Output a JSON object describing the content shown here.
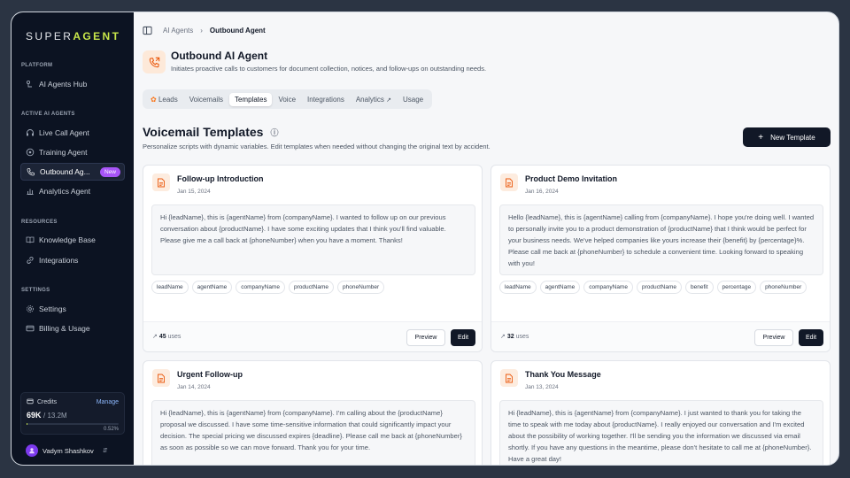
{
  "sidebar": {
    "brand_a": "SUPER",
    "brand_b": "AGENT",
    "sections": {
      "platform": "PLATFORM",
      "active": "ACTIVE AI AGENTS",
      "resources": "RESOURCES",
      "settings": "SETTINGS"
    },
    "items": {
      "hub": "AI Agents Hub",
      "live": "Live Call Agent",
      "training": "Training Agent",
      "outbound": "Outbound Ag...",
      "analytics": "Analytics Agent",
      "kb": "Knowledge Base",
      "integrations": "Integrations",
      "settings": "Settings",
      "billing": "Billing & Usage"
    },
    "new_badge": "New",
    "credits": {
      "label": "Credits",
      "manage": "Manage",
      "used": "69K",
      "total": "/ 13.2M",
      "percent": "0.52%",
      "fraction": 0.0052
    },
    "user": "Vadym Shashkov"
  },
  "breadcrumb": {
    "parent": "AI Agents",
    "current": "Outbound Agent"
  },
  "agent": {
    "title": "Outbound AI Agent",
    "subtitle": "Initiates proactive calls to customers for document collection, notices, and follow-ups on outstanding needs."
  },
  "tabs": {
    "leads": "Leads",
    "voicemails": "Voicemails",
    "templates": "Templates",
    "voice": "Voice",
    "integrations": "Integrations",
    "analytics": "Analytics",
    "usage": "Usage"
  },
  "page": {
    "title": "Voicemail Templates",
    "subtitle": "Personalize scripts with dynamic variables. Edit templates when needed without changing the original text by accident.",
    "new_button": "New Template"
  },
  "cards": [
    {
      "title": "Follow-up Introduction",
      "date": "Jan 15, 2024",
      "body": "Hi {leadName}, this is {agentName} from {companyName}. I wanted to follow up on our previous conversation about {productName}. I have some exciting updates that I think you'll find valuable. Please give me a call back at {phoneNumber} when you have a moment. Thanks!",
      "chips": [
        "leadName",
        "agentName",
        "companyName",
        "productName",
        "phoneNumber"
      ],
      "uses": "45",
      "uses_label": "uses",
      "preview": "Preview",
      "edit": "Edit"
    },
    {
      "title": "Product Demo Invitation",
      "date": "Jan 16, 2024",
      "body": "Hello {leadName}, this is {agentName} calling from {companyName}. I hope you're doing well. I wanted to personally invite you to a product demonstration of {productName} that I think would be perfect for your business needs. We've helped companies like yours increase their {benefit} by {percentage}%. Please call me back at {phoneNumber} to schedule a convenient time. Looking forward to speaking with you!",
      "chips": [
        "leadName",
        "agentName",
        "companyName",
        "productName",
        "benefit",
        "percentage",
        "phoneNumber"
      ],
      "uses": "32",
      "uses_label": "uses",
      "preview": "Preview",
      "edit": "Edit"
    },
    {
      "title": "Urgent Follow-up",
      "date": "Jan 14, 2024",
      "body": "Hi {leadName}, this is {agentName} from {companyName}. I'm calling about the {productName} proposal we discussed. I have some time-sensitive information that could significantly impact your decision. The special pricing we discussed expires {deadline}. Please call me back at {phoneNumber} as soon as possible so we can move forward. Thank you for your time."
    },
    {
      "title": "Thank You Message",
      "date": "Jan 13, 2024",
      "body": "Hi {leadName}, this is {agentName} from {companyName}. I just wanted to thank you for taking the time to speak with me today about {productName}. I really enjoyed our conversation and I'm excited about the possibility of working together. I'll be sending you the information we discussed via email shortly. If you have any questions in the meantime, please don't hesitate to call me at {phoneNumber}. Have a great day!"
    }
  ]
}
